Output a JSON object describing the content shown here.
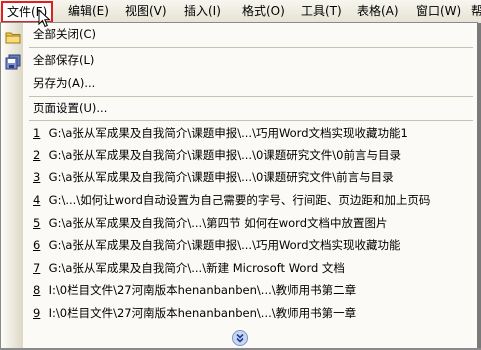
{
  "menubar": {
    "items": [
      "文件(F)",
      "编辑(E)",
      "视图(V)",
      "插入(I)",
      "格式(O)",
      "工具(T)",
      "表格(A)",
      "窗口(W)",
      "帮"
    ]
  },
  "file_menu": {
    "close_all": "全部关闭(C)",
    "save_all": "全部保存(L)",
    "save_as": "另存为(A)...",
    "page_setup": "页面设置(U)...",
    "recent_files": [
      {
        "num": "1",
        "path": "G:\\a张从军成果及自我简介\\课题申报\\...\\巧用Word文档实现收藏功能1"
      },
      {
        "num": "2",
        "path": "G:\\a张从军成果及自我简介\\课题申报\\...\\0课题研究文件\\0前言与目录"
      },
      {
        "num": "3",
        "path": "G:\\a张从军成果及自我简介\\课题申报\\...\\0课题研究文件\\前言与目录"
      },
      {
        "num": "4",
        "path": "G:\\...\\如何让word自动设置为自己需要的字号、行间距、页边距和加上页码"
      },
      {
        "num": "5",
        "path": "G:\\a张从军成果及自我简介\\...\\第四节 如何在word文档中放置图片"
      },
      {
        "num": "6",
        "path": "G:\\a张从军成果及自我简介\\课题申报\\...\\巧用Word文档实现收藏功能"
      },
      {
        "num": "7",
        "path": "G:\\a张从军成果及自我简介\\...\\新建 Microsoft Word 文档"
      },
      {
        "num": "8",
        "path": "I:\\0栏目文件\\27河南版本henanbanben\\...\\教师用书第二章"
      },
      {
        "num": "9",
        "path": "I:\\0栏目文件\\27河南版本henanbanben\\...\\教师用书第一章"
      }
    ],
    "expand_icon": "double-chevron-down-icon"
  }
}
